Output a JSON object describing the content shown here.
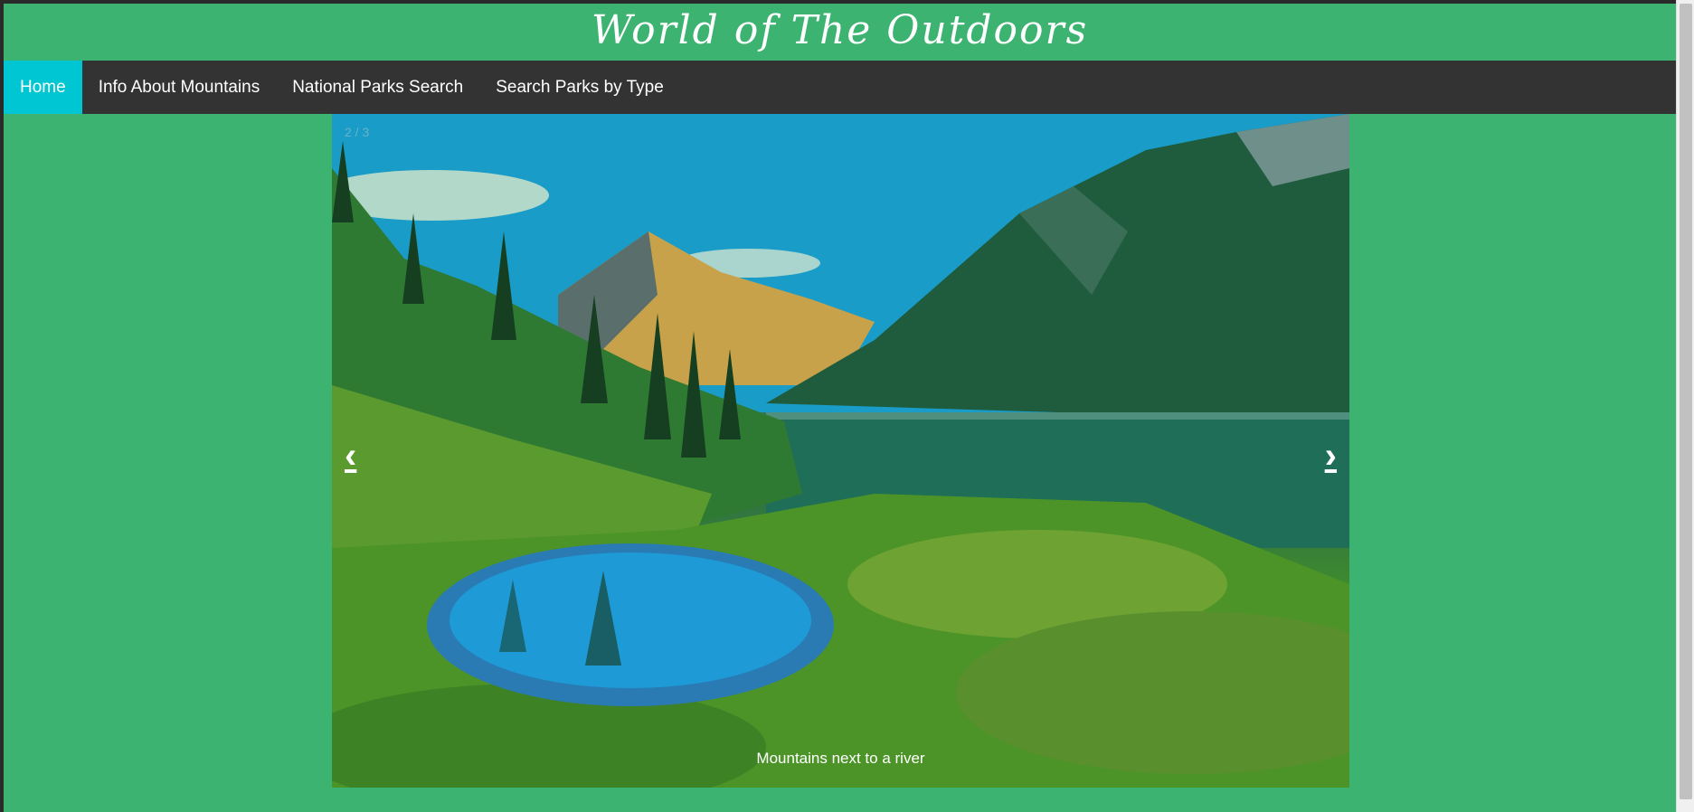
{
  "site": {
    "title": "World of The Outdoors"
  },
  "nav": {
    "items": [
      {
        "label": "Home",
        "active": true
      },
      {
        "label": "Info About Mountains",
        "active": false
      },
      {
        "label": "National Parks Search",
        "active": false
      },
      {
        "label": "Search Parks by Type",
        "active": false
      }
    ]
  },
  "slideshow": {
    "counter": "2 / 3",
    "prev_icon": "‹",
    "next_icon": "›",
    "caption": "Mountains next to a river"
  },
  "colors": {
    "page_background": "#3cb371",
    "navbar_background": "#333333",
    "active_nav": "#00c5d3"
  }
}
